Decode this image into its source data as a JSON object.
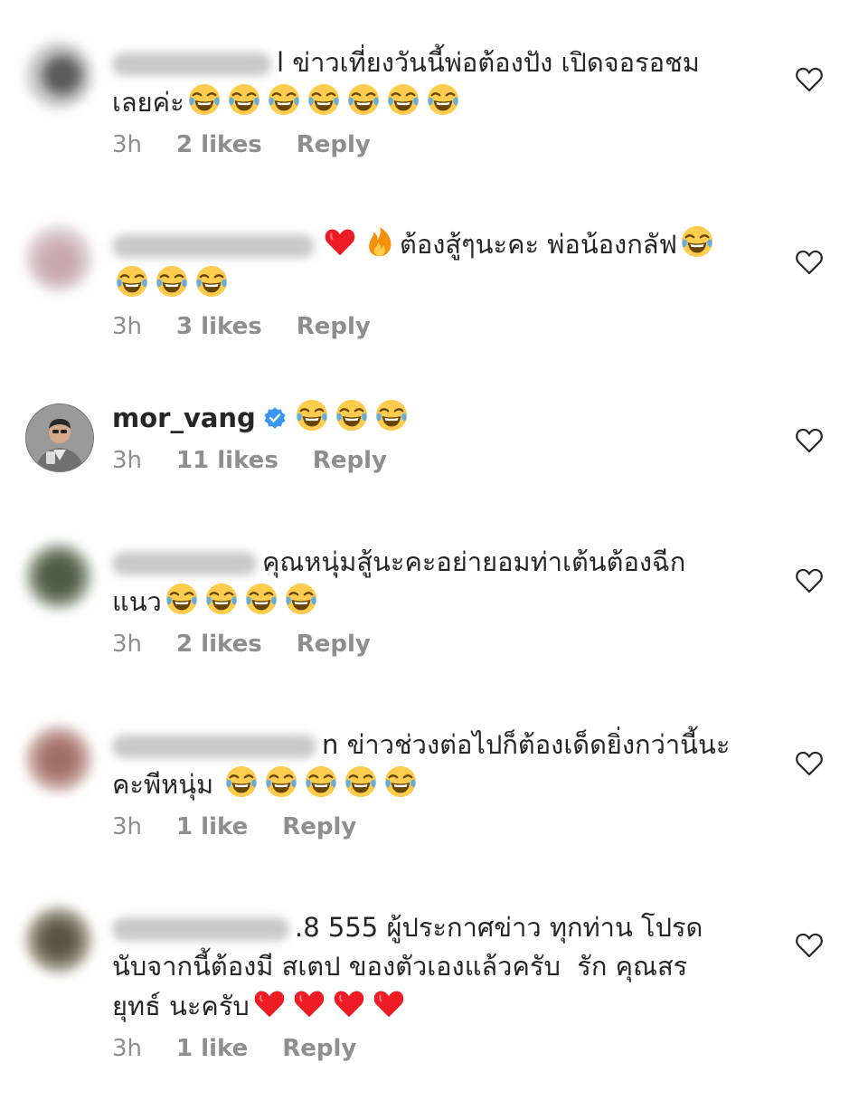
{
  "comments": [
    {
      "username": "",
      "username_blurred": true,
      "text_line1": "l ข่าวเที่ยงวันนี้พ่อต้องปัง เปิดจอรอชม",
      "text_line2": "เลยค่ะ",
      "emojis_line2": [
        "joy",
        "joy",
        "joy",
        "joy",
        "joy",
        "joy",
        "joy"
      ],
      "time": "3h",
      "likes": "2 likes",
      "reply": "Reply",
      "liked": false
    },
    {
      "username": "",
      "username_blurred": true,
      "text_line1": "ต้องสู้ๆนะคะ พ่อน้องกลัฟ",
      "emojis_before_line1": [
        "heart",
        "fire"
      ],
      "emojis_line1_end": [
        "joy"
      ],
      "emojis_line2": [
        "joy",
        "joy",
        "joy"
      ],
      "time": "3h",
      "likes": "3 likes",
      "reply": "Reply",
      "liked": false
    },
    {
      "username": "mor_vang",
      "username_blurred": false,
      "verified": true,
      "emojis_line1": [
        "joy",
        "joy",
        "joy"
      ],
      "time": "3h",
      "likes": "11 likes",
      "reply": "Reply",
      "liked": false
    },
    {
      "username": "",
      "username_blurred": true,
      "text_line1": "คุณหนุ่มสู้นะคะอย่ายอมท่าเต้นต้องฉีก",
      "text_line2": "แนว",
      "emojis_line2": [
        "joy",
        "joy",
        "joy",
        "joy"
      ],
      "time": "3h",
      "likes": "2 likes",
      "reply": "Reply",
      "liked": false
    },
    {
      "username": "",
      "username_blurred": true,
      "text_line1": "n ข่าวช่วงต่อไปก็ต้องเด็ดยิ่งกว่านี้นะ",
      "text_line2": "คะพีหนุ่ม ",
      "emojis_line2": [
        "joy",
        "joy",
        "joy",
        "joy",
        "joy"
      ],
      "time": "3h",
      "likes": "1 like",
      "reply": "Reply",
      "liked": false
    },
    {
      "username": "",
      "username_blurred": true,
      "text_line1": ".8 555 ผู้ประกาศข่าว ทุกท่าน โปรด",
      "text_line2": "นับจากนี้ต้องมี สเตป ของตัวเองแล้วครับ  รัก คุณสร",
      "text_line3": "ยุทธ์ นะครับ",
      "emojis_line3": [
        "heart",
        "heart",
        "heart",
        "heart"
      ],
      "time": "3h",
      "likes": "1 like",
      "reply": "Reply",
      "liked": false
    }
  ],
  "icons": {
    "like": "heart-outline-icon",
    "verified": "verified-badge-icon"
  },
  "colors": {
    "text": "#262626",
    "meta": "#8e8e8e",
    "verified": "#3897f0",
    "heart_red": "#ed1c24"
  }
}
